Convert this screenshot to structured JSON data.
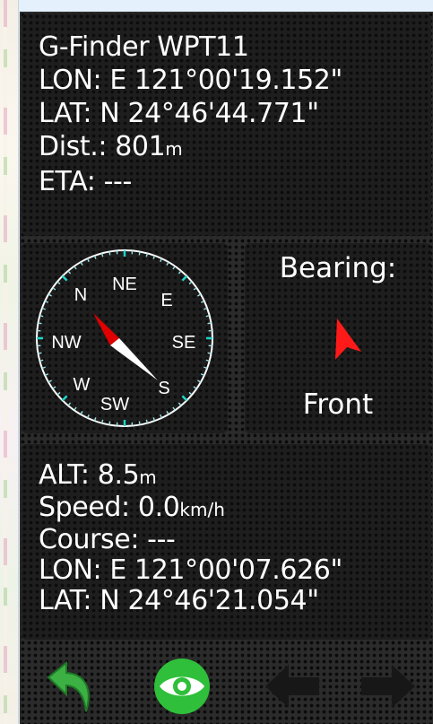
{
  "target": {
    "title": "G-Finder WPT11",
    "lon_label": "LON: E 121°00'19.152\"",
    "lat_label": "LAT: N  24°46'44.771\"",
    "dist_prefix": "Dist.: 801",
    "dist_unit": "m",
    "eta_label": "ETA: ---"
  },
  "compass": {
    "labels": [
      "N",
      "NE",
      "E",
      "SE",
      "S",
      "SW",
      "W",
      "NW"
    ]
  },
  "bearing": {
    "label": "Bearing:",
    "direction": "Front"
  },
  "current": {
    "alt_prefix": "ALT: 8.5",
    "alt_unit": "m",
    "speed_prefix": "Speed: 0.0",
    "speed_unit": "km/h",
    "course_label": "Course: ---",
    "lon_label": "LON: E 121°00'07.626\"",
    "lat_label": "LAT: N  24°46'21.054\""
  },
  "toolbar": {
    "buttons": [
      "back-icon",
      "eye-icon",
      "previous-arrow-icon",
      "next-arrow-icon"
    ]
  },
  "colors": {
    "needle_north": "#e00000",
    "needle_south": "#ffffff",
    "bearing_arrow": "#ff1a1a",
    "back_icon": "#3cb043",
    "eye_icon": "#2fbf3a"
  }
}
